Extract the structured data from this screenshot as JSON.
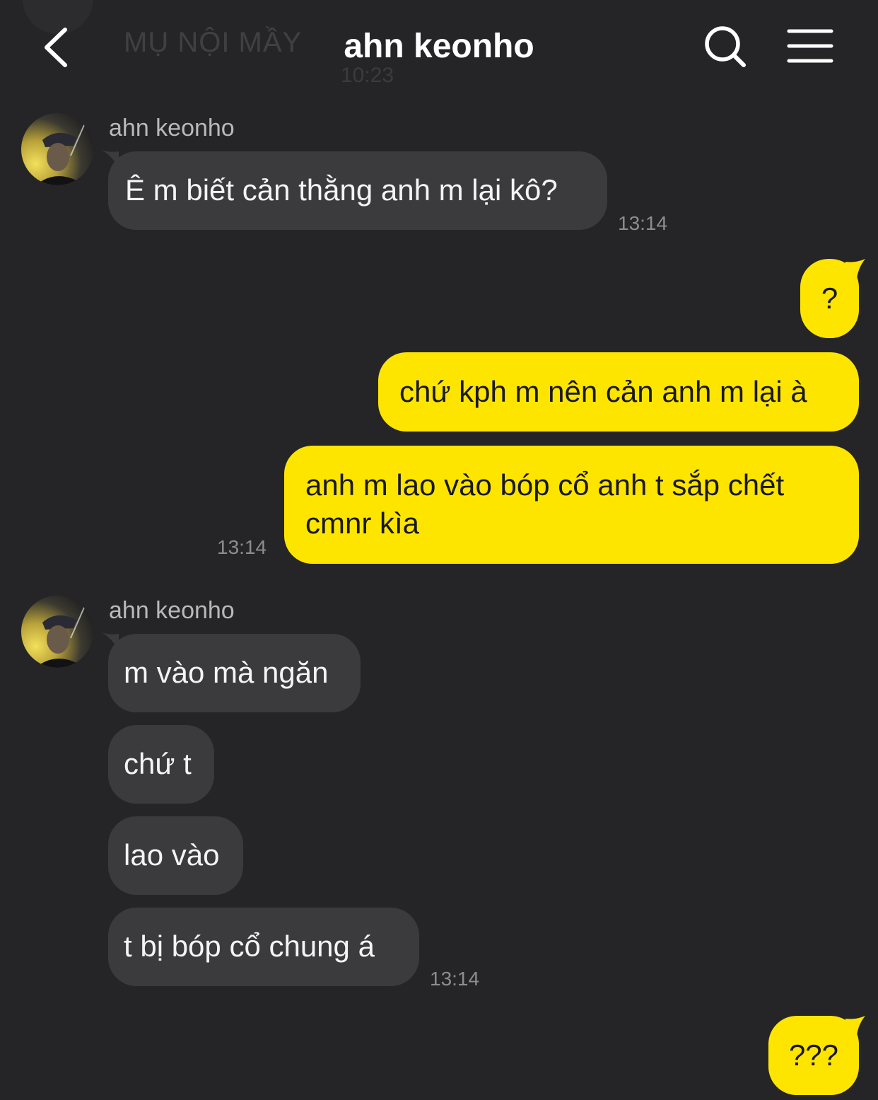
{
  "header": {
    "title": "ahn keonho",
    "background_preview": {
      "text": "MỤ NỘI MẦY",
      "time": "10:23"
    }
  },
  "icons": {
    "back": "chevron-left-icon",
    "search": "search-icon",
    "menu": "hamburger-menu-icon",
    "avatar": "contact-avatar-photo"
  },
  "colors": {
    "background": "#252527",
    "incoming_bubble": "#3b3b3d",
    "outgoing_bubble": "#fee500",
    "timestamp": "#8d8d90",
    "sender_name": "#b9b9bb"
  },
  "messages": {
    "group1": {
      "sender": "ahn keonho",
      "m1": "Ê m biết cản thằng anh m lại kô?",
      "time": "13:14"
    },
    "group2": {
      "m1": "?",
      "m2": "chứ kph m nên cản anh m lại à",
      "m3_line1": "anh m lao vào bóp cổ anh t sắp chết",
      "m3_line2": "cmnr kìa",
      "time": "13:14"
    },
    "group3": {
      "sender": "ahn keonho",
      "m1": "m vào mà ngăn",
      "m2": "chứ t",
      "m3": "lao vào",
      "m4": "t bị bóp cổ chung á",
      "time": "13:14"
    },
    "group4": {
      "m1": "???"
    }
  }
}
